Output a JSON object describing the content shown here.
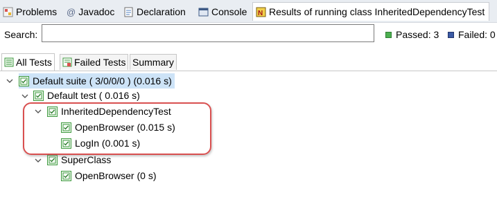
{
  "view_tabs": [
    {
      "label": "Problems",
      "icon": "problems-icon"
    },
    {
      "label": "Javadoc",
      "icon": "javadoc-icon"
    },
    {
      "label": "Declaration",
      "icon": "declaration-icon"
    },
    {
      "label": "Console",
      "icon": "console-icon"
    },
    {
      "label": "Results of running class InheritedDependencyTest",
      "icon": "testng-icon"
    }
  ],
  "search": {
    "label": "Search:",
    "value": "",
    "placeholder": ""
  },
  "stats": {
    "passed": "Passed: 3",
    "failed": "Failed: 0"
  },
  "sub_tabs": [
    {
      "label": "All Tests",
      "icon": "all-tests-icon"
    },
    {
      "label": "Failed Tests",
      "icon": "failed-tests-icon"
    },
    {
      "label": "Summary"
    }
  ],
  "tree": {
    "suite": "Default suite ( 3/0/0/0 ) (0.016 s)",
    "test": "Default test ( 0.016 s)",
    "class1": "InheritedDependencyTest",
    "method1": "OpenBrowser  (0.015 s)",
    "method2": "LogIn  (0.001 s)",
    "class2": "SuperClass",
    "method3": "OpenBrowser  (0 s)"
  },
  "colors": {
    "selection": "#cde3f7",
    "highlight_border": "#d94f4f",
    "pass_green": "#3e9a3e"
  }
}
